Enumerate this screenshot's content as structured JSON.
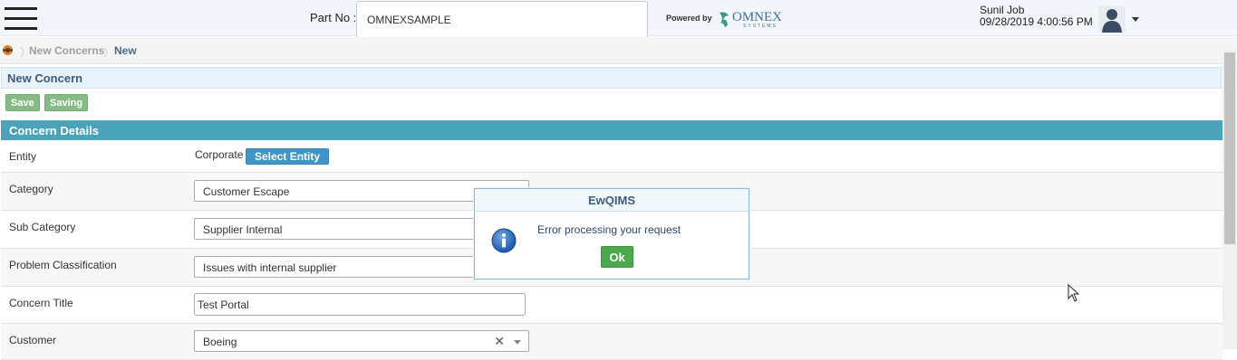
{
  "header": {
    "partno_label": "Part No :",
    "partno_value": "OMNEXSAMPLE",
    "powered_by": "Powered by",
    "brand_name": "OMNEX",
    "brand_sub": "SYSTEMS",
    "user_name": "Sunil Job",
    "user_datetime": "09/28/2019 4:00:56 PM"
  },
  "breadcrumb": {
    "home_icon": "home-icon",
    "items": [
      "New Concerns",
      "New"
    ]
  },
  "page": {
    "title": "New Concern",
    "save_label": "Save",
    "saving_label": "Saving"
  },
  "section": {
    "title": "Concern Details"
  },
  "form": {
    "entity_label": "Entity",
    "entity_value": "Corporate",
    "select_entity_label": "Select Entity",
    "category_label": "Category",
    "category_value": "Customer Escape",
    "sub_category_label": "Sub Category",
    "sub_category_value": "Supplier Internal",
    "problem_label": "Problem Classification",
    "problem_value": "Issues with internal supplier",
    "title_label": "Concern Title",
    "title_value": "Test Portal",
    "customer_label": "Customer",
    "customer_value": "Boeing",
    "clear_glyph": "✕"
  },
  "dialog": {
    "title": "EwQIMS",
    "message": "Error processing your request",
    "ok_label": "Ok",
    "icon": "info-icon"
  },
  "colors": {
    "section_header": "#4aa3b9",
    "save_button": "#86bb86",
    "select_entity_button": "#3e96c8",
    "ok_button": "#4da84d",
    "page_title_text": "#3d5d7d"
  }
}
